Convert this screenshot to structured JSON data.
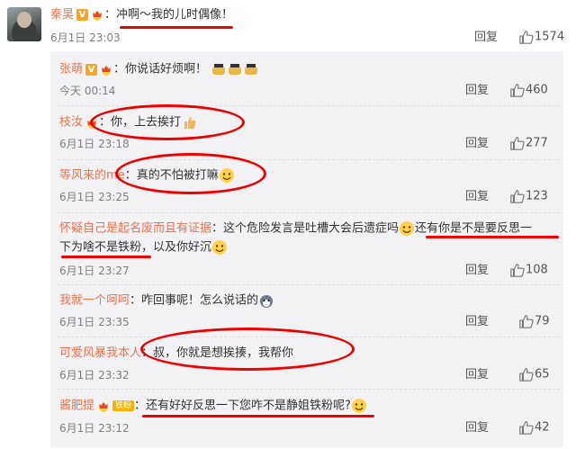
{
  "top": {
    "name": "秦昊",
    "text": "冲啊～我的儿时偶像！",
    "time": "6月1日 23:03",
    "reply": "回复",
    "likes": "1574"
  },
  "replies": [
    {
      "name": "张萌",
      "text": "你说话好烦啊！",
      "time": "今天 00:14",
      "reply": "回复",
      "likes": "460"
    },
    {
      "name": "枝汝",
      "text": "你，上去挨打",
      "time": "6月1日 23:18",
      "reply": "回复",
      "likes": "277"
    },
    {
      "name": "等风来的me",
      "text": "真的不怕被打嘛",
      "time": "6月1日 23:25",
      "reply": "回复",
      "likes": "123"
    },
    {
      "name": "怀疑自己是起名废而且有证据",
      "text": "这个危险发言是吐槽大会后遗症吗",
      "text2": "还有你是不是要反思一",
      "text3": "下为啥不是铁粉",
      "text4": "，以及你好沉",
      "time": "6月1日 23:27",
      "reply": "回复",
      "likes": "108"
    },
    {
      "name": "我就一个呵呵",
      "text": "咋回事呢！怎么说话的",
      "time": "6月1日 23:35",
      "reply": "回复",
      "likes": "79"
    },
    {
      "name": "可爱风暴我本人",
      "text": "叔，你就是想挨揍，我帮你",
      "time": "6月1日 23:32",
      "reply": "回复",
      "likes": "65"
    },
    {
      "name": "酱肥提",
      "badge": "铁粉",
      "text": "还有好好反思一下您咋不是静姐铁粉呢?",
      "time": "6月1日 23:12",
      "reply": "回复",
      "likes": "42"
    }
  ],
  "colors": {
    "name": "#eb7350",
    "annotation": "#e00000",
    "panel": "#f2f2f5"
  }
}
